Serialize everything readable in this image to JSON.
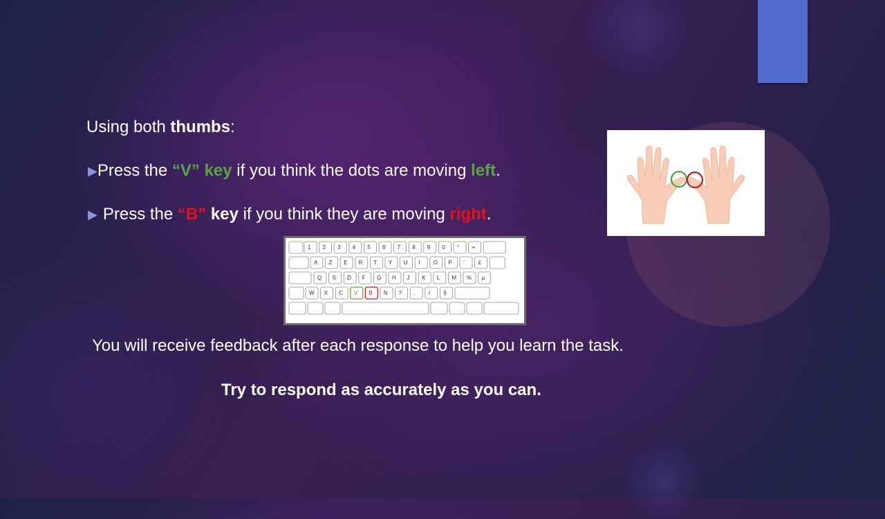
{
  "slide": {
    "intro": {
      "text": "Using both ",
      "bold": "thumbs",
      "end": ":"
    },
    "bullet1": {
      "pre": "Press the ",
      "key": "“V” key",
      "mid": " if you think the dots are moving ",
      "direction": "left",
      "end": "."
    },
    "bullet2": {
      "pre": "Press the ",
      "key_quoted": "“B”",
      "key_word": " key",
      "mid": " if you think they are moving ",
      "direction": "right",
      "end": "."
    },
    "feedback": "You will receive feedback after each response to help you learn the task.",
    "accuracy": "Try to respond as accurately as you can."
  },
  "keyboard": {
    "row1": [
      "1",
      "2",
      "3",
      "4",
      "5",
      "6",
      "7",
      "8",
      "9",
      "0",
      "°",
      "+"
    ],
    "row2": [
      "A",
      "Z",
      "E",
      "R",
      "T",
      "Y",
      "U",
      "I",
      "O",
      "P",
      "¨",
      "£"
    ],
    "row3": [
      "Q",
      "S",
      "D",
      "F",
      "G",
      "H",
      "J",
      "K",
      "L",
      "M",
      "%",
      "µ"
    ],
    "row4": [
      "W",
      "X",
      "C",
      "V",
      "B",
      "N",
      "?",
      ".",
      "/",
      "§"
    ],
    "left_key": "V",
    "right_key": "B"
  },
  "colors": {
    "left": "#58a73f",
    "right": "#e2131a",
    "accent_bar": "#4f6ccd",
    "bullet_arrow": "#8a96dc"
  },
  "icons": {
    "bullet": "triangle-right-icon",
    "hands": "hands-thumbs-image",
    "keyboard": "keyboard-image"
  }
}
